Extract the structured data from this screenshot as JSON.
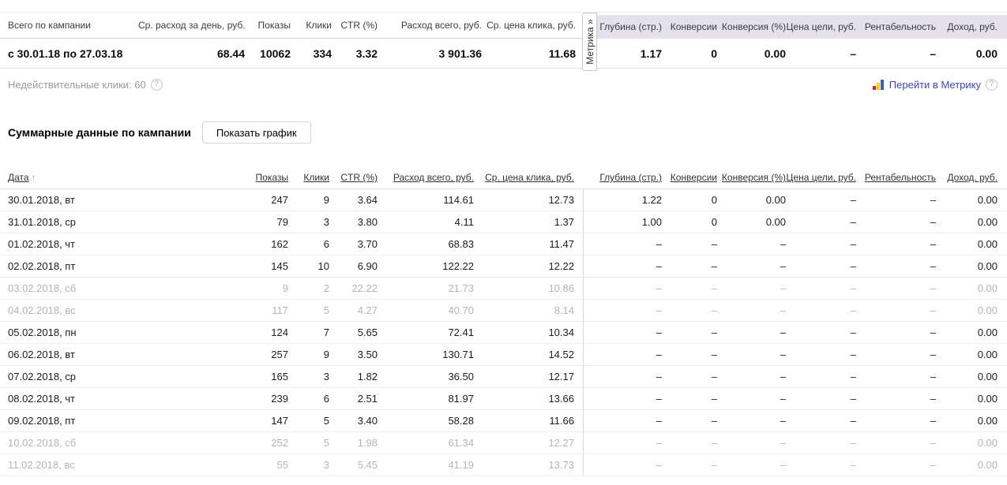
{
  "colors": {
    "link_blue": "#3b46c3",
    "metrika_header_bg": "#e4e1ec",
    "muted_text": "#b4b4b4",
    "metrika_icon_red": "#e0261c",
    "metrika_icon_yellow": "#fdcb00",
    "metrika_icon_blue": "#2d63c8"
  },
  "summary": {
    "left": {
      "headers": [
        "Всего по кампании",
        "Ср. расход за день, руб.",
        "Показы",
        "Клики",
        "CTR (%)",
        "Расход всего, руб.",
        "Ср. цена клика, руб."
      ],
      "values": [
        "с 30.01.18 по 27.03.18",
        "68.44",
        "10062",
        "334",
        "3.32",
        "3 901.36",
        "11.68"
      ]
    },
    "metrika_tab": {
      "label": "Метрика",
      "chevron": "»"
    },
    "right": {
      "headers": [
        "Глубина (стр.)",
        "Конверсии",
        "Конверсия (%)",
        "Цена цели, руб.",
        "Рентабельность",
        "Доход, руб."
      ],
      "values": [
        "1.17",
        "0",
        "0.00",
        "–",
        "–",
        "0.00"
      ]
    }
  },
  "invalid_clicks": {
    "text": "Недействительные клики: 60",
    "help_icon": "?"
  },
  "metrika_link": {
    "text": "Перейти в Метрику",
    "help_icon": "?"
  },
  "section_header": {
    "title": "Суммарные данные по кампании",
    "show_chart_button_label": "Показать график"
  },
  "table": {
    "sort_arrow": "↑",
    "headers": [
      "Дата",
      "Показы",
      "Клики",
      "CTR (%)",
      "Расход всего, руб.",
      "Ср. цена клика, руб.",
      "Глубина (стр.)",
      "Конверсии",
      "Конверсия (%)",
      "Цена цели, руб.",
      "Рентабельность",
      "Доход, руб."
    ],
    "rows": [
      {
        "muted": false,
        "cells": [
          "30.01.2018, вт",
          "247",
          "9",
          "3.64",
          "114.61",
          "12.73",
          "1.22",
          "0",
          "0.00",
          "–",
          "–",
          "0.00"
        ]
      },
      {
        "muted": false,
        "cells": [
          "31.01.2018, ср",
          "79",
          "3",
          "3.80",
          "4.11",
          "1.37",
          "1.00",
          "0",
          "0.00",
          "–",
          "–",
          "0.00"
        ]
      },
      {
        "muted": false,
        "cells": [
          "01.02.2018, чт",
          "162",
          "6",
          "3.70",
          "68.83",
          "11.47",
          "–",
          "–",
          "–",
          "–",
          "–",
          "0.00"
        ]
      },
      {
        "muted": false,
        "cells": [
          "02.02.2018, пт",
          "145",
          "10",
          "6.90",
          "122.22",
          "12.22",
          "–",
          "–",
          "–",
          "–",
          "–",
          "0.00"
        ]
      },
      {
        "muted": true,
        "cells": [
          "03.02.2018, сб",
          "9",
          "2",
          "22.22",
          "21.73",
          "10.86",
          "–",
          "–",
          "–",
          "–",
          "–",
          "0.00"
        ]
      },
      {
        "muted": true,
        "cells": [
          "04.02.2018, вс",
          "117",
          "5",
          "4.27",
          "40.70",
          "8.14",
          "–",
          "–",
          "–",
          "–",
          "–",
          "0.00"
        ]
      },
      {
        "muted": false,
        "cells": [
          "05.02.2018, пн",
          "124",
          "7",
          "5.65",
          "72.41",
          "10.34",
          "–",
          "–",
          "–",
          "–",
          "–",
          "0.00"
        ]
      },
      {
        "muted": false,
        "cells": [
          "06.02.2018, вт",
          "257",
          "9",
          "3.50",
          "130.71",
          "14.52",
          "–",
          "–",
          "–",
          "–",
          "–",
          "0.00"
        ]
      },
      {
        "muted": false,
        "cells": [
          "07.02.2018, ср",
          "165",
          "3",
          "1.82",
          "36.50",
          "12.17",
          "–",
          "–",
          "–",
          "–",
          "–",
          "0.00"
        ]
      },
      {
        "muted": false,
        "cells": [
          "08.02.2018, чт",
          "239",
          "6",
          "2.51",
          "81.97",
          "13.66",
          "–",
          "–",
          "–",
          "–",
          "–",
          "0.00"
        ]
      },
      {
        "muted": false,
        "cells": [
          "09.02.2018, пт",
          "147",
          "5",
          "3.40",
          "58.28",
          "11.66",
          "–",
          "–",
          "–",
          "–",
          "–",
          "0.00"
        ]
      },
      {
        "muted": true,
        "cells": [
          "10.02.2018, сб",
          "252",
          "5",
          "1.98",
          "61.34",
          "12.27",
          "–",
          "–",
          "–",
          "–",
          "–",
          "0.00"
        ]
      },
      {
        "muted": true,
        "cells": [
          "11.02.2018, вс",
          "55",
          "3",
          "5.45",
          "41.19",
          "13.73",
          "–",
          "–",
          "–",
          "–",
          "–",
          "0.00"
        ]
      }
    ]
  }
}
